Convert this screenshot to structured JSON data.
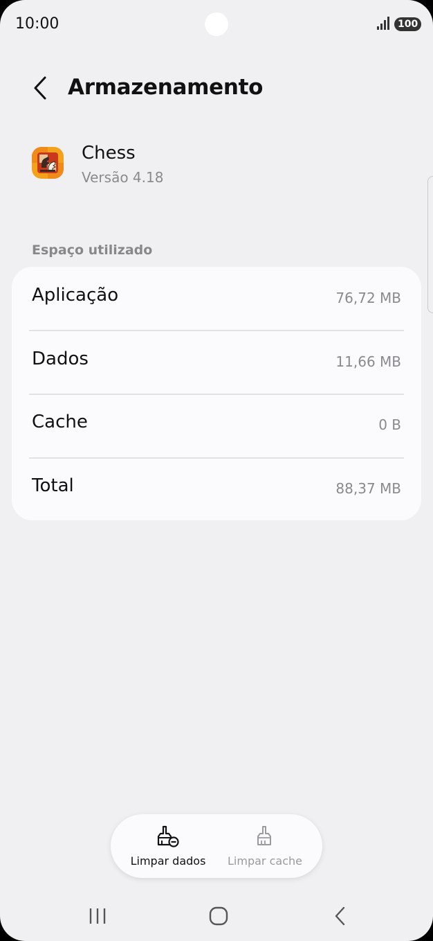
{
  "status_bar": {
    "time": "10:00",
    "battery": "100",
    "signal_icon": "signal-icon"
  },
  "header": {
    "title": "Armazenamento",
    "back_icon": "chevron-left-icon"
  },
  "app": {
    "name": "Chess",
    "version": "Versão 4.18",
    "icon": "chess-app-icon"
  },
  "storage": {
    "section_label": "Espaço utilizado",
    "rows": [
      {
        "label": "Aplicação",
        "value": "76,72 MB"
      },
      {
        "label": "Dados",
        "value": "11,66 MB"
      },
      {
        "label": "Cache",
        "value": "0 B"
      },
      {
        "label": "Total",
        "value": "88,37 MB"
      }
    ]
  },
  "actions": {
    "clear_data": {
      "label": "Limpar dados",
      "icon": "broom-clear-icon",
      "enabled": true
    },
    "clear_cache": {
      "label": "Limpar cache",
      "icon": "broom-icon",
      "enabled": false
    }
  },
  "nav": {
    "recents_icon": "recents-icon",
    "home_icon": "home-icon",
    "back_icon": "back-icon"
  },
  "colors": {
    "background": "#f0f0f2",
    "card": "#fbfbfd",
    "text": "#111111",
    "secondary": "#8a8a8e",
    "disabled": "#9a9a9e"
  }
}
